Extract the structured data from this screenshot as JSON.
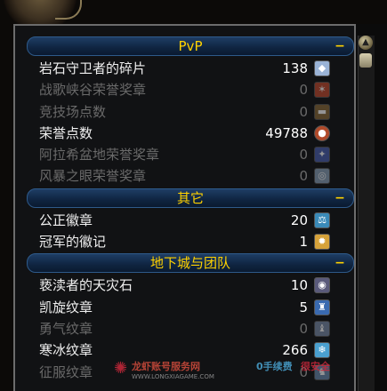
{
  "sections": [
    {
      "title": "PvP",
      "collapse": "−",
      "rows": [
        {
          "name": "岩石守卫者的碎片",
          "count": "138",
          "icon": "shard-icon",
          "color": "#9ab3d6",
          "dim": false
        },
        {
          "name": "战歌峡谷荣誉奖章",
          "count": "0",
          "icon": "warsong-mark-icon",
          "color": "#c0492e",
          "dim": true
        },
        {
          "name": "竞技场点数",
          "count": "0",
          "icon": "arena-icon",
          "color": "#8a6a3a",
          "dim": true
        },
        {
          "name": "荣誉点数",
          "count": "49788",
          "icon": "honor-icon",
          "color": "#b04a2a",
          "dim": false
        },
        {
          "name": "阿拉希盆地荣誉奖章",
          "count": "0",
          "icon": "arathi-mark-icon",
          "color": "#4a5fb0",
          "dim": true
        },
        {
          "name": "风暴之眼荣誉奖章",
          "count": "0",
          "icon": "eots-mark-icon",
          "color": "#8aa0b8",
          "dim": true
        }
      ]
    },
    {
      "title": "其它",
      "collapse": "−",
      "rows": [
        {
          "name": "公正徽章",
          "count": "20",
          "icon": "justice-icon",
          "color": "#3a8ab8",
          "dim": false
        },
        {
          "name": "冠军的徽记",
          "count": "1",
          "icon": "champion-seal-icon",
          "color": "#d6a23a",
          "dim": false
        }
      ]
    },
    {
      "title": "地下城与团队",
      "collapse": "−",
      "rows": [
        {
          "name": "亵渎者的天灾石",
          "count": "10",
          "icon": "scourgestone-icon",
          "color": "#5a5a7a",
          "dim": false
        },
        {
          "name": "凯旋纹章",
          "count": "5",
          "icon": "triumph-icon",
          "color": "#3a6ab0",
          "dim": false
        },
        {
          "name": "勇气纹章",
          "count": "0",
          "icon": "valor-icon",
          "color": "#7a8aa8",
          "dim": true
        },
        {
          "name": "寒冰纹章",
          "count": "266",
          "icon": "frost-icon",
          "color": "#4aa0d0",
          "dim": false
        },
        {
          "name": "征服纹章",
          "count": "0",
          "icon": "conquest-icon",
          "color": "#6a8ab0",
          "dim": true
        }
      ]
    }
  ],
  "watermark": {
    "line1": "龙虾账号服务网",
    "line2": "WWW.LONGXIAGAME.COM",
    "line3": "0手续费",
    "line4": "很安全"
  }
}
